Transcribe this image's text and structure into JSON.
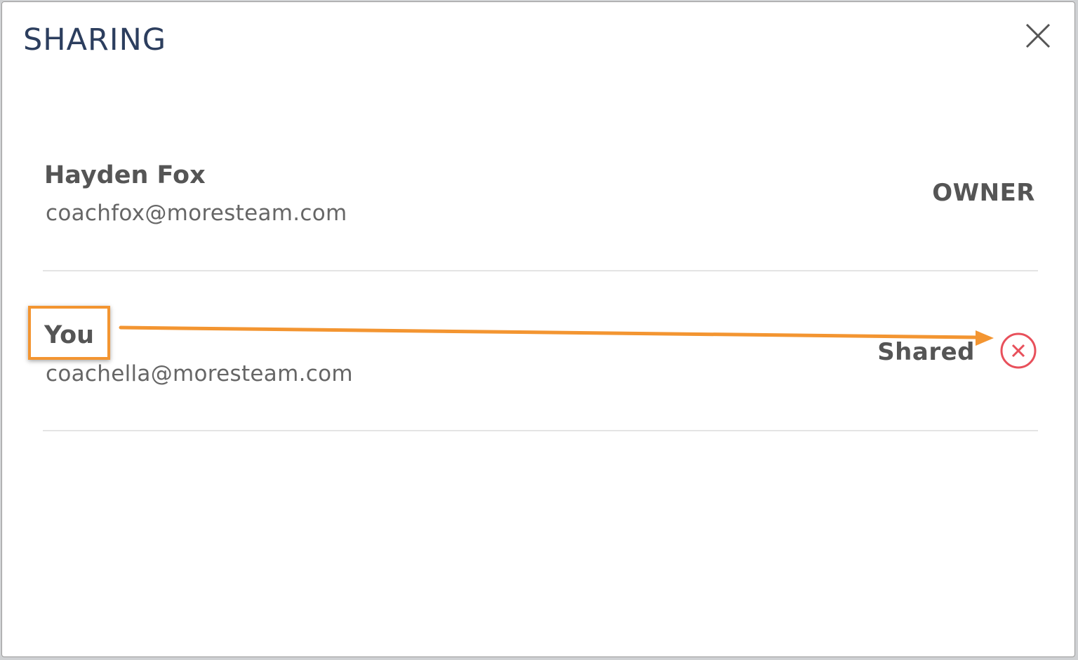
{
  "dialog": {
    "title": "SHARING",
    "close_icon": "close-icon"
  },
  "shares": [
    {
      "name": "Hayden Fox",
      "email": "coachfox@moresteam.com",
      "role": "OWNER"
    },
    {
      "name": "You",
      "email": "coachella@moresteam.com",
      "role": "Shared",
      "remove_icon": "circle-x-icon"
    }
  ],
  "colors": {
    "title": "#2c3e5e",
    "annotation": "#f39531",
    "remove": "#e8505b"
  }
}
